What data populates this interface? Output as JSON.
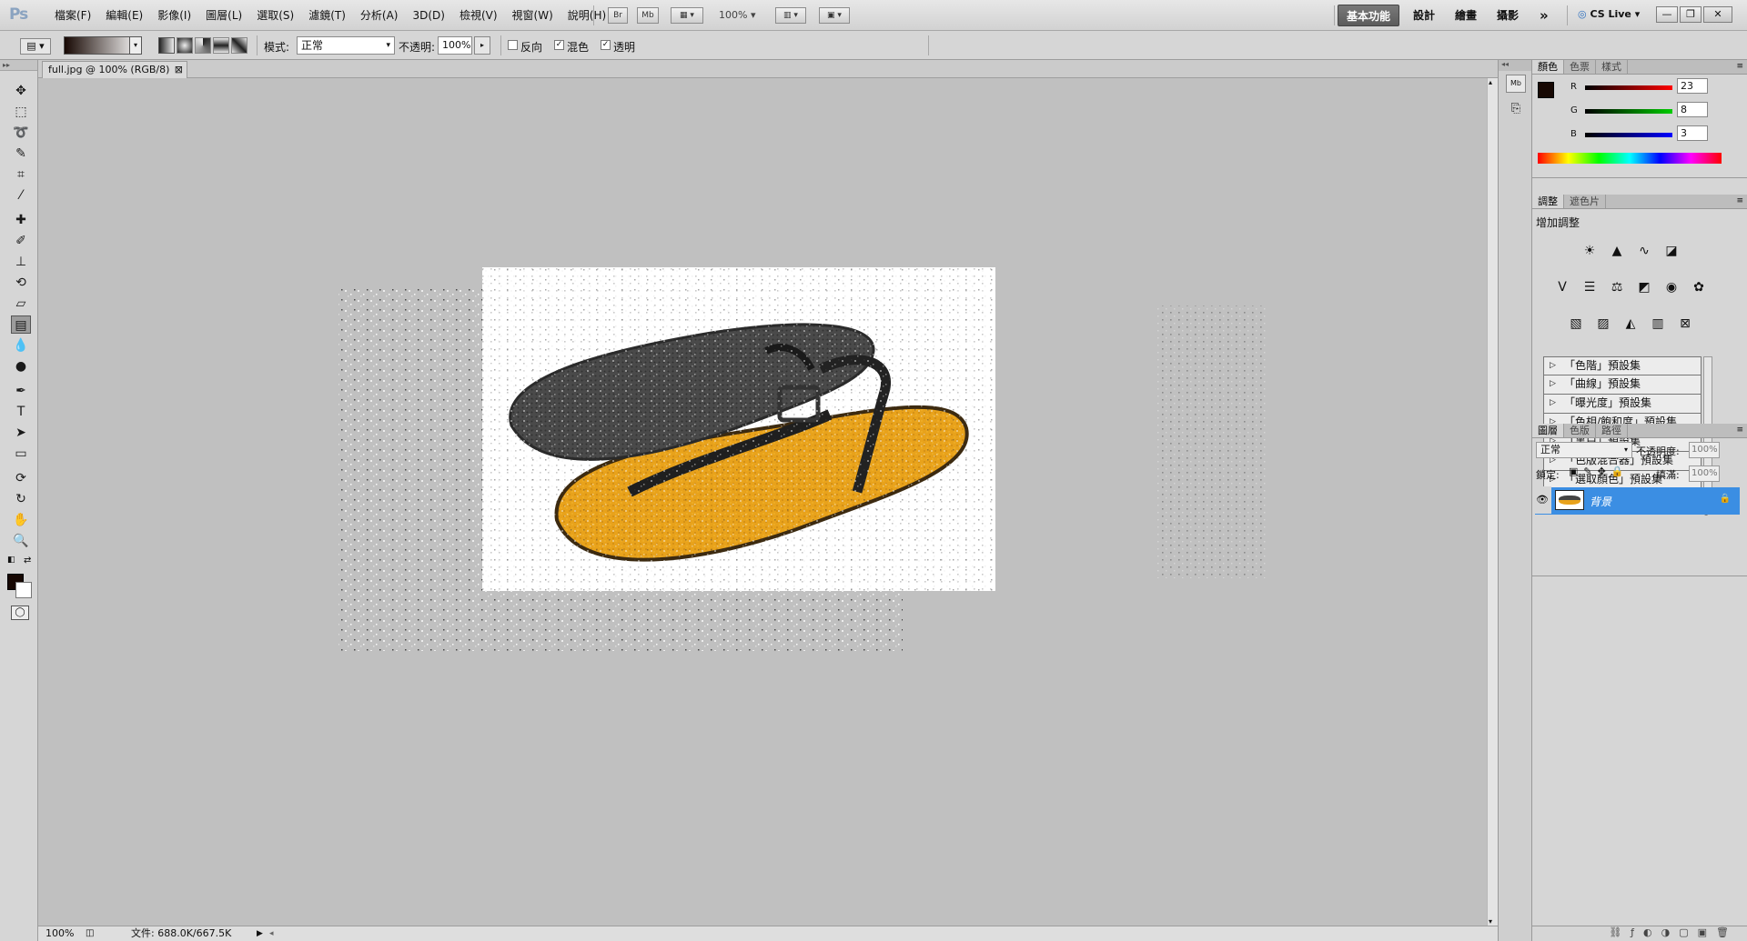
{
  "app": {
    "logo": "Ps"
  },
  "menubar": {
    "items": [
      "檔案(F)",
      "編輯(E)",
      "影像(I)",
      "圖層(L)",
      "選取(S)",
      "濾鏡(T)",
      "分析(A)",
      "3D(D)",
      "檢視(V)",
      "視窗(W)",
      "說明(H)"
    ],
    "br_label": "Br",
    "mb_label": "Mb",
    "zoom": "100%",
    "workspaces": [
      "基本功能",
      "設計",
      "繪畫",
      "攝影"
    ],
    "more": "»",
    "cslive": "CS Live",
    "win_min": "—",
    "win_restore": "❐",
    "win_close": "✕"
  },
  "options": {
    "mode_label": "模式:",
    "mode_value": "正常",
    "opacity_label": "不透明:",
    "opacity_value": "100%",
    "reverse_label": "反向",
    "dither_label": "混色",
    "transparency_label": "透明"
  },
  "document": {
    "tab_title": "full.jpg @ 100% (RGB/8)",
    "tab_close": "⊠",
    "zoom": "100%",
    "doc_info": "文件: 688.0K/667.5K"
  },
  "color_panel": {
    "tabs": [
      "顏色",
      "色票",
      "樣式"
    ],
    "r_label": "R",
    "g_label": "G",
    "b_label": "B",
    "r": "23",
    "g": "8",
    "b": "3",
    "fg_color": "#170803"
  },
  "adjust_panel": {
    "tabs": [
      "調整",
      "遮色片"
    ],
    "title": "增加調整",
    "presets": [
      "「色階」預設集",
      "「曲線」預設集",
      "「曝光度」預設集",
      "「色相/飽和度」預設集",
      "「黑白」預設集",
      "「色版混合器」預設集",
      "「選取顏色」預設集"
    ]
  },
  "layers_panel": {
    "tabs": [
      "圖層",
      "色版",
      "路徑"
    ],
    "blend_mode": "正常",
    "opacity_label": "不透明度:",
    "opacity_value": "100%",
    "lock_label": "鎖定:",
    "fill_label": "填滿:",
    "fill_value": "100%",
    "layer_name": "背景"
  }
}
